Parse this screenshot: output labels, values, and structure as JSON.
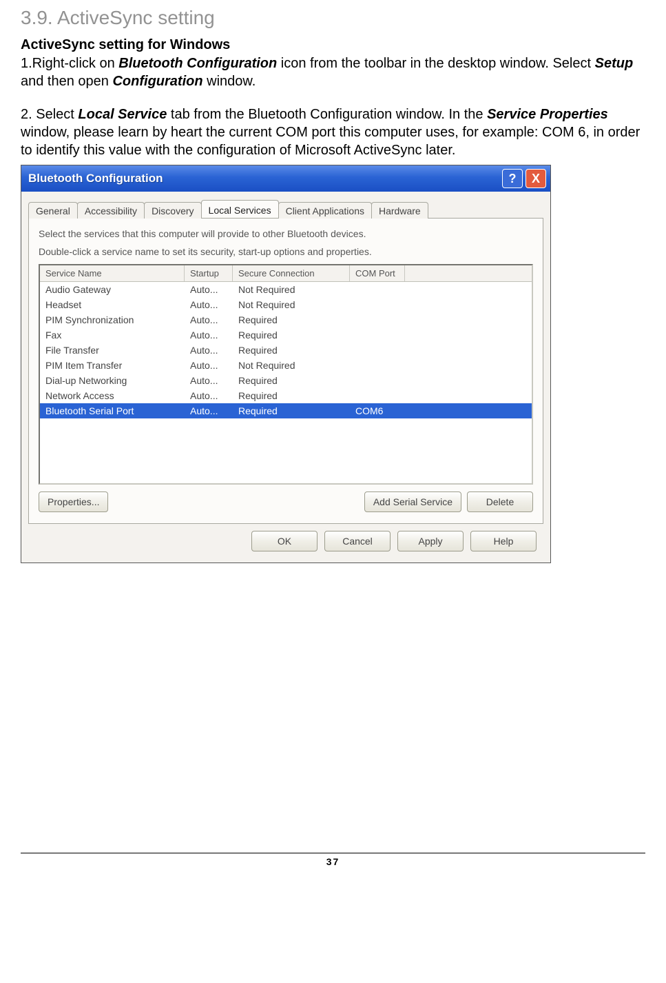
{
  "heading": "3.9. ActiveSync setting",
  "subheading": "ActiveSync setting for Windows",
  "step1": {
    "prefix": "1.Right-click on ",
    "t1": "Bluetooth Configuration",
    "mid1": " icon from the toolbar in the desktop window. Select ",
    "t2": "Setup",
    "mid2": " and then open ",
    "t3": "Configuration",
    "suffix": " window."
  },
  "step2": {
    "prefix": "2. Select ",
    "t1": "Local Service",
    "mid1": " tab from the Bluetooth Configuration window. In the ",
    "t2": "Service Properties",
    "suffix": " window, please learn by heart the current COM port this computer uses, for example: COM 6, in order to identify this value with the configuration of Microsoft ActiveSync later."
  },
  "dialog": {
    "title": "Bluetooth Configuration",
    "help": "?",
    "close": "X",
    "tabs": {
      "general": "General",
      "accessibility": "Accessibility",
      "discovery": "Discovery",
      "local_services": "Local Services",
      "client_applications": "Client Applications",
      "hardware": "Hardware"
    },
    "panel_line1": "Select the services that this computer will provide to other Bluetooth devices.",
    "panel_line2": "Double-click a service name to set its security, start-up options and properties.",
    "columns": {
      "name": "Service Name",
      "startup": "Startup",
      "secure": "Secure Connection",
      "com": "COM Port"
    },
    "rows": [
      {
        "name": "Audio Gateway",
        "startup": "Auto...",
        "secure": "Not Required",
        "com": ""
      },
      {
        "name": "Headset",
        "startup": "Auto...",
        "secure": "Not Required",
        "com": ""
      },
      {
        "name": "PIM Synchronization",
        "startup": "Auto...",
        "secure": "Required",
        "com": ""
      },
      {
        "name": "Fax",
        "startup": "Auto...",
        "secure": "Required",
        "com": ""
      },
      {
        "name": "File Transfer",
        "startup": "Auto...",
        "secure": "Required",
        "com": ""
      },
      {
        "name": "PIM Item Transfer",
        "startup": "Auto...",
        "secure": "Not Required",
        "com": ""
      },
      {
        "name": "Dial-up Networking",
        "startup": "Auto...",
        "secure": "Required",
        "com": ""
      },
      {
        "name": "Network Access",
        "startup": "Auto...",
        "secure": "Required",
        "com": ""
      },
      {
        "name": "Bluetooth Serial Port",
        "startup": "Auto...",
        "secure": "Required",
        "com": "COM6",
        "selected": true
      }
    ],
    "buttons": {
      "properties": "Properties...",
      "add_serial": "Add Serial Service",
      "delete": "Delete",
      "ok": "OK",
      "cancel": "Cancel",
      "apply": "Apply",
      "help_btn": "Help"
    }
  },
  "page_number": "37"
}
